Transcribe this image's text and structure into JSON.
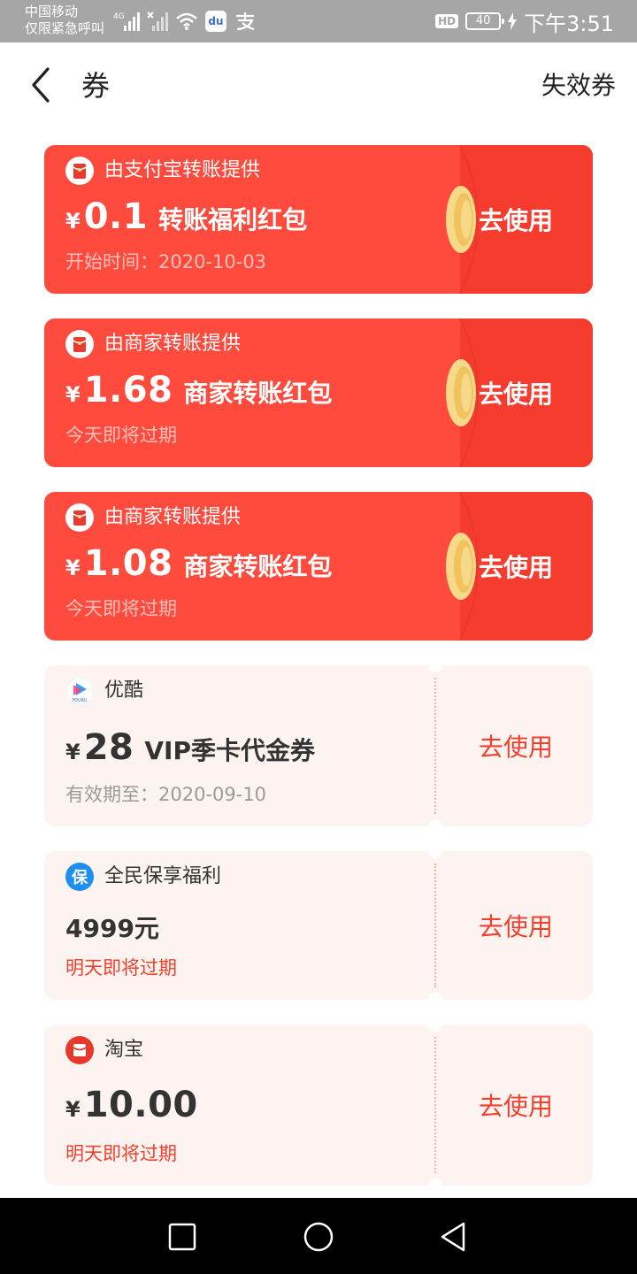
{
  "status_bar": {
    "carrier_line1": "中国移动",
    "carrier_line2": "仅限紧急呼叫",
    "network": "4G",
    "hd": "HD",
    "battery": "40",
    "time": "下午3:51"
  },
  "header": {
    "back_icon": "chevron-left-icon",
    "title": "券",
    "expired_label": "失效券"
  },
  "red_coupons": [
    {
      "provider": "由支付宝转账提供",
      "currency": "¥",
      "amount": "0.1",
      "name": "转账福利红包",
      "sub": "开始时间：2020-10-03",
      "action": "去使用"
    },
    {
      "provider": "由商家转账提供",
      "currency": "¥",
      "amount": "1.68",
      "name": "商家转账红包",
      "sub": "今天即将过期",
      "action": "去使用"
    },
    {
      "provider": "由商家转账提供",
      "currency": "¥",
      "amount": "1.08",
      "name": "商家转账红包",
      "sub": "今天即将过期",
      "action": "去使用"
    }
  ],
  "coupons": [
    {
      "provider": "优酷",
      "provider_icon": "youku-logo-icon",
      "currency": "¥",
      "amount": "28",
      "name": "VIP季卡代金券",
      "sub": "有效期至：2020-09-10",
      "action": "去使用"
    },
    {
      "provider": "全民保享福利",
      "provider_icon": "insurance-badge-icon",
      "icon_text": "保",
      "amount_text": "4999元",
      "sub": "明天即将过期",
      "action": "去使用"
    },
    {
      "provider": "淘宝",
      "provider_icon": "taobao-logo-icon",
      "currency": "¥",
      "amount": "10.00",
      "sub": "明天即将过期",
      "action": "去使用"
    }
  ],
  "colors": {
    "red_card": "#ff4a3e",
    "red_card_right": "#f63b2f",
    "coupon_bg": "#fdf4f1",
    "accent_text": "#f2402c",
    "status_bar": "#a6a6a6"
  },
  "nav_bar": [
    "recent-apps-icon",
    "home-icon",
    "back-triangle-icon"
  ]
}
